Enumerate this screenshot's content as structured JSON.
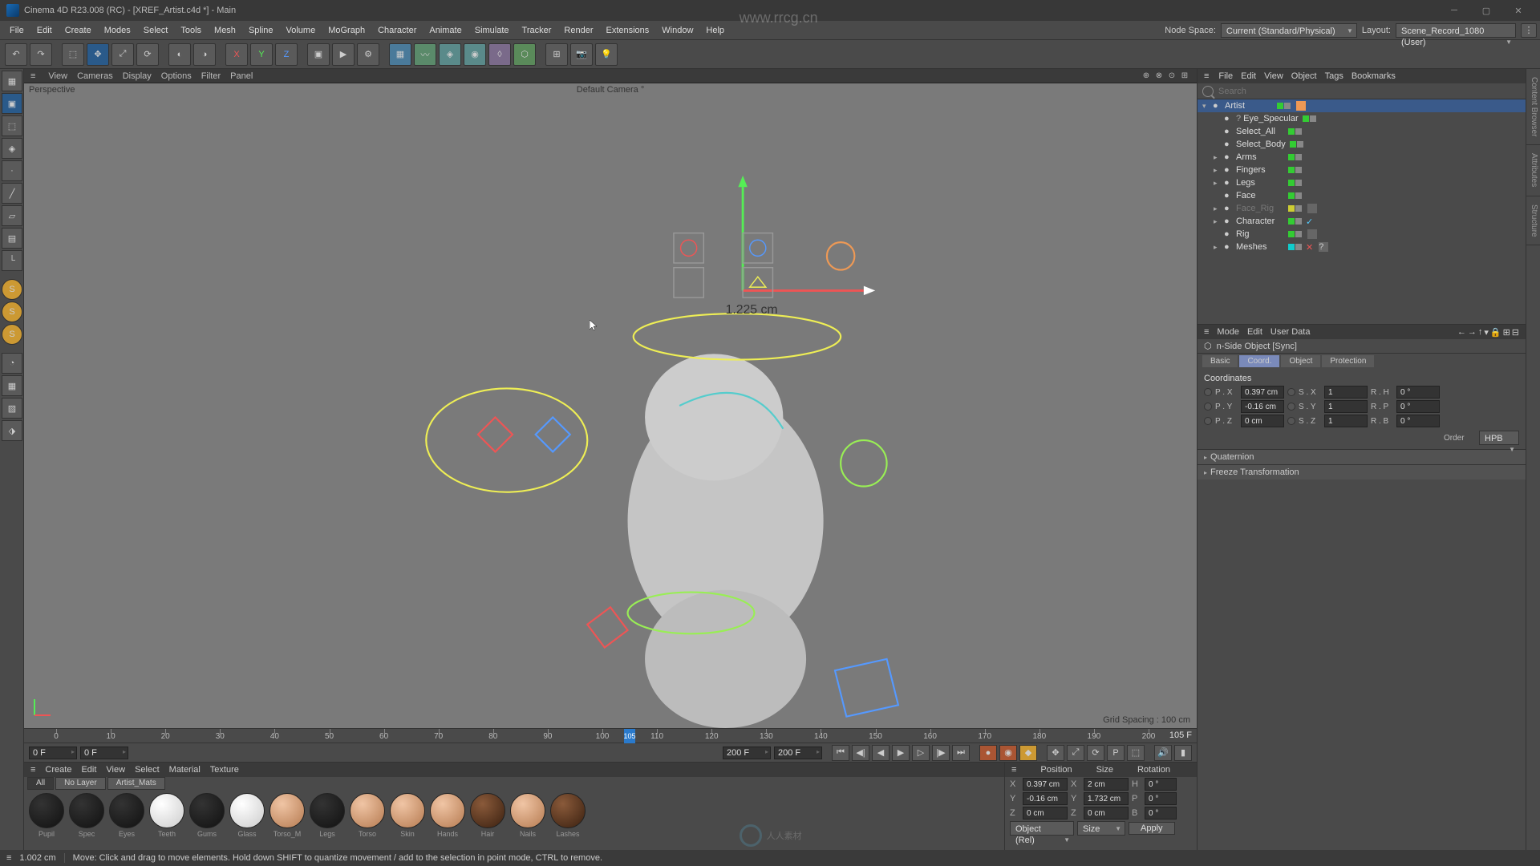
{
  "title": "Cinema 4D R23.008 (RC) - [XREF_Artist.c4d *] - Main",
  "watermark_top": "www.rrcg.cn",
  "watermark_bottom": "人人素材",
  "menu": [
    "File",
    "Edit",
    "Create",
    "Modes",
    "Select",
    "Tools",
    "Mesh",
    "Spline",
    "Volume",
    "MoGraph",
    "Character",
    "Animate",
    "Simulate",
    "Tracker",
    "Render",
    "Extensions",
    "Window",
    "Help"
  ],
  "node_space_label": "Node Space:",
  "node_space_value": "Current (Standard/Physical)",
  "layout_label": "Layout:",
  "layout_value": "Scene_Record_1080 (User)",
  "viewport": {
    "tabs": [
      "View",
      "Cameras",
      "Display",
      "Options",
      "Filter",
      "Panel"
    ],
    "label": "Perspective",
    "camera": "Default Camera °",
    "gizmo_dist": "1.225 cm",
    "grid": "Grid Spacing : 100 cm"
  },
  "timeline": {
    "ticks": [
      0,
      10,
      20,
      30,
      40,
      50,
      60,
      70,
      80,
      90,
      100,
      110,
      120,
      130,
      140,
      150,
      160,
      170,
      180,
      190,
      200
    ],
    "ticks_visible": [
      0,
      10,
      20,
      30,
      40,
      50,
      60,
      70,
      80,
      90,
      100,
      110,
      120,
      130,
      140,
      150,
      160,
      170,
      180,
      190,
      200
    ],
    "label_spacing": 47,
    "current": 105,
    "current_label": "105",
    "end_label": "105 F",
    "f0": "0 F",
    "f0b": "0 F",
    "f200a": "200 F",
    "f200b": "200 F"
  },
  "materials": {
    "menu": [
      "Create",
      "Edit",
      "View",
      "Select",
      "Material",
      "Texture"
    ],
    "tabs": [
      "All",
      "No Layer",
      "Artist_Mats"
    ],
    "active_tab": 0,
    "items": [
      "Pupil",
      "Spec",
      "Eyes",
      "Teeth",
      "Gums",
      "Glass",
      "Torso_M",
      "Legs",
      "Torso",
      "Skin",
      "Hands",
      "Hair",
      "Nails",
      "Lashes"
    ]
  },
  "coord_panel": {
    "headers": [
      "Position",
      "Size",
      "Rotation"
    ],
    "rows": [
      {
        "k": "X",
        "p": "0.397 cm",
        "s": "2 cm",
        "rK": "H",
        "r": "0 °"
      },
      {
        "k": "Y",
        "p": "-0.16 cm",
        "s": "1.732 cm",
        "rK": "P",
        "r": "0 °"
      },
      {
        "k": "Z",
        "p": "0 cm",
        "s": "0 cm",
        "rK": "B",
        "r": "0 °"
      }
    ],
    "mode1": "Object (Rel)",
    "mode2": "Size",
    "apply": "Apply"
  },
  "obj_menu": [
    "File",
    "Edit",
    "View",
    "Object",
    "Tags",
    "Bookmarks"
  ],
  "search_placeholder": "Search",
  "objects": [
    {
      "depth": 0,
      "exp": "▾",
      "name": "Artist",
      "col": "g",
      "tags": [
        "layer-orange"
      ],
      "sel": true
    },
    {
      "depth": 1,
      "exp": "",
      "name": "Eye_Specular",
      "col": "g",
      "pre": "?"
    },
    {
      "depth": 1,
      "exp": "",
      "name": "Select_All",
      "col": "g"
    },
    {
      "depth": 1,
      "exp": "",
      "name": "Select_Body",
      "col": "g"
    },
    {
      "depth": 1,
      "exp": "▸",
      "name": "Arms",
      "col": "g"
    },
    {
      "depth": 1,
      "exp": "▸",
      "name": "Fingers",
      "col": "g"
    },
    {
      "depth": 1,
      "exp": "▸",
      "name": "Legs",
      "col": "g"
    },
    {
      "depth": 1,
      "exp": "",
      "name": "Face",
      "col": "g"
    },
    {
      "depth": 1,
      "exp": "▸",
      "name": "Face_Rig",
      "col": "y",
      "dim": true,
      "tags": [
        "dots"
      ]
    },
    {
      "depth": 1,
      "exp": "▸",
      "name": "Character",
      "col": "g",
      "chk": true
    },
    {
      "depth": 1,
      "exp": "",
      "name": "Rig",
      "col": "g",
      "tags": [
        "dots"
      ]
    },
    {
      "depth": 1,
      "exp": "▸",
      "name": "Meshes",
      "col": "c",
      "x": true,
      "tags": [
        "?"
      ]
    }
  ],
  "attr": {
    "menu": [
      "Mode",
      "Edit",
      "User Data"
    ],
    "header": "n-Side Object [Sync]",
    "tabs": [
      "Basic",
      "Coord.",
      "Object",
      "Protection"
    ],
    "active_tab": 1,
    "section": "Coordinates",
    "rows": [
      {
        "p": "P . X",
        "pv": "0.397 cm",
        "s": "S . X",
        "sv": "1",
        "r": "R . H",
        "rv": "0 °"
      },
      {
        "p": "P . Y",
        "pv": "-0.16 cm",
        "s": "S . Y",
        "sv": "1",
        "r": "R . P",
        "rv": "0 °"
      },
      {
        "p": "P . Z",
        "pv": "0 cm",
        "s": "S . Z",
        "sv": "1",
        "r": "R . B",
        "rv": "0 °"
      }
    ],
    "order_label": "Order",
    "order_value": "HPB",
    "collapse": [
      "Quaternion",
      "Freeze Transformation"
    ]
  },
  "status": {
    "dist": "1.002 cm",
    "hint": "Move: Click and drag to move elements. Hold down SHIFT to quantize movement / add to the selection in point mode, CTRL to remove."
  },
  "right_tabs": [
    "Content Browser",
    "Attributes",
    "Structure"
  ]
}
